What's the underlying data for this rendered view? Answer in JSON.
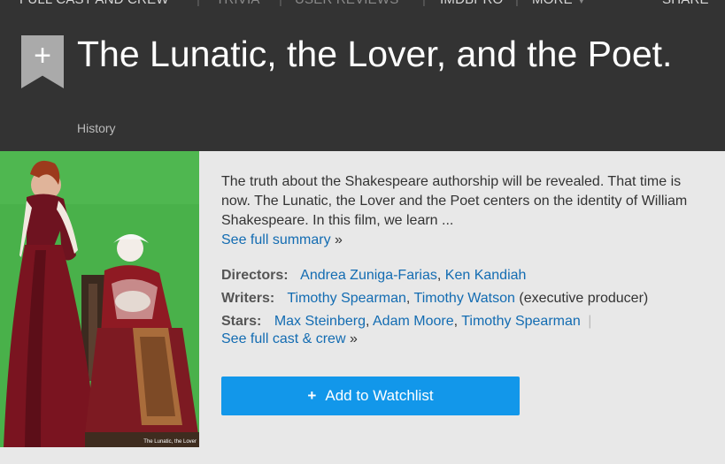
{
  "topnav": {
    "items": [
      "FULL CAST AND CREW",
      "TRIVIA",
      "USER REVIEWS",
      "IMDbPro",
      "MORE"
    ],
    "separator": "|",
    "share": "SHARE"
  },
  "header": {
    "ribbon_plus": "+",
    "title": "The Lunatic, the Lover, and the Poet.",
    "genre": "History"
  },
  "poster": {
    "caption": "The Lunatic, the Lover"
  },
  "summary": {
    "text": "The truth about the Shakespeare authorship will be revealed. That time is now. The Lunatic, the Lover and the Poet centers on the identity of William Shakespeare. In this film, we learn ...",
    "see_full_label": "See full summary",
    "arrow": "»"
  },
  "credits": {
    "directors_label": "Directors:",
    "directors": [
      "Andrea Zuniga-Farias",
      "Ken Kandiah"
    ],
    "writers_label": "Writers:",
    "writers": [
      "Timothy Spearman",
      "Timothy Watson"
    ],
    "writers_note": "(executive producer)",
    "stars_label": "Stars:",
    "stars": [
      "Max Steinberg",
      "Adam Moore",
      "Timothy Spearman"
    ],
    "pipe": "|",
    "full_cast_label": "See full cast & crew",
    "arrow": "»",
    "comma": ","
  },
  "watchlist": {
    "plus": "+",
    "label": "Add to Watchlist"
  },
  "colors": {
    "header_bg": "#333333",
    "page_bg": "#e8e8e8",
    "link": "#136cb2",
    "button": "#1297ea"
  }
}
